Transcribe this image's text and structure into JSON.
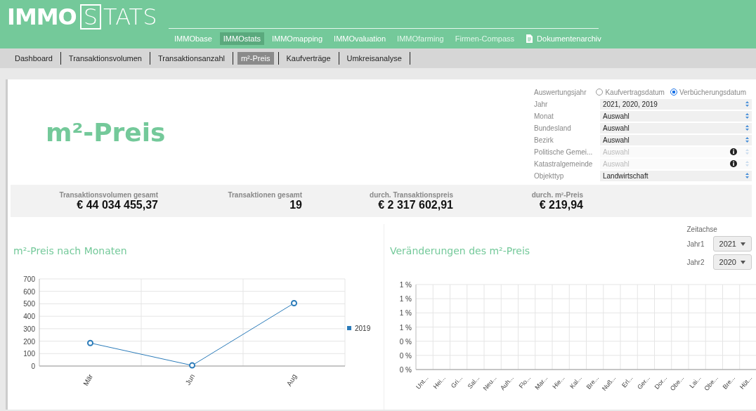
{
  "logo": {
    "bold": "IMMO",
    "boxed": "S",
    "rest": "TATS"
  },
  "nav": [
    {
      "label": "IMMObase",
      "selected": false,
      "disabled": false
    },
    {
      "label": "IMMOstats",
      "selected": true,
      "disabled": false
    },
    {
      "label": "IMMOmapping",
      "selected": false,
      "disabled": false
    },
    {
      "label": "IMMOvaluation",
      "selected": false,
      "disabled": false
    },
    {
      "label": "IMMOfarming",
      "selected": false,
      "disabled": true
    },
    {
      "label": "Firmen-Compass",
      "selected": false,
      "disabled": true
    },
    {
      "label": "Dokumentenarchiv",
      "selected": false,
      "disabled": false,
      "kind": "document"
    }
  ],
  "subnav": [
    {
      "label": "Dashboard",
      "selected": false
    },
    {
      "label": "Transaktionsvolumen",
      "selected": false
    },
    {
      "label": "Transaktionsanzahl",
      "selected": false
    },
    {
      "label": "m²-Preis",
      "selected": true
    },
    {
      "label": "Kaufverträge",
      "selected": false
    },
    {
      "label": "Umkreisanalyse",
      "selected": false
    }
  ],
  "page_title": "m²-Preis",
  "filters": {
    "radio_label": "Auswertungsjahr",
    "radio_options": [
      {
        "label": "Kaufvertragsdatum",
        "selected": false
      },
      {
        "label": "Verbücherungsdatum",
        "selected": true
      }
    ],
    "rows": [
      {
        "label": "Jahr",
        "value": "2021, 2020, 2019",
        "disabled": false,
        "info": false
      },
      {
        "label": "Monat",
        "value": "Auswahl",
        "disabled": false,
        "info": false
      },
      {
        "label": "Bundesland",
        "value": "Auswahl",
        "disabled": false,
        "info": false
      },
      {
        "label": "Bezirk",
        "value": "Auswahl",
        "disabled": false,
        "info": false
      },
      {
        "label": "Politische Gemei...",
        "value": "Auswahl",
        "disabled": true,
        "info": true
      },
      {
        "label": "Katastralgemeinde",
        "value": "Auswahl",
        "disabled": true,
        "info": true
      },
      {
        "label": "Objekttyp",
        "value": "Landwirtschaft",
        "disabled": false,
        "info": false
      }
    ]
  },
  "stats": [
    {
      "label": "Transaktionsvolumen gesamt",
      "value": "€ 44 034 455,37"
    },
    {
      "label": "Transaktionen gesamt",
      "value": "19"
    },
    {
      "label": "durch. Transaktionspreis",
      "value": "€ 2 317 602,91"
    },
    {
      "label": "durch. m²-Preis",
      "value": "€ 219,94"
    }
  ],
  "monthly_chart": {
    "title": "m²-Preis nach Monaten",
    "chart_data": {
      "type": "line",
      "categories": [
        "Mär",
        "Jun",
        "Aug"
      ],
      "series": [
        {
          "name": "2019",
          "color": "#2b7bb9",
          "values": [
            185,
            5,
            505
          ],
          "marker": "circle"
        }
      ],
      "grid": true,
      "ylim": [
        0,
        700
      ],
      "yticks": [
        0,
        100,
        200,
        300,
        400,
        500,
        600,
        700
      ]
    }
  },
  "change_chart": {
    "title": "Veränderungen des m²-Preis",
    "axis_label": "Zeitachse",
    "selects": [
      {
        "label": "Jahr1",
        "value": "2021"
      },
      {
        "label": "Jahr2",
        "value": "2020"
      }
    ],
    "chart_data": {
      "type": "line",
      "categories": [
        "Unt...",
        "Hei...",
        "Gri...",
        "Sal...",
        "Neu...",
        "Auh...",
        "Flo...",
        "Mar...",
        "Hie...",
        "Kal...",
        "Bre...",
        "Nuß...",
        "Erl...",
        "Ger...",
        "Dor...",
        "Obe...",
        "Lai...",
        "Obe...",
        "Bre...",
        "Hüt..."
      ],
      "grid": true,
      "ylim": [
        0,
        1.2
      ],
      "yticks": [
        {
          "value": 0,
          "label": "0 %"
        },
        {
          "value": 0.2,
          "label": "0 %"
        },
        {
          "value": 0.4,
          "label": "0 %"
        },
        {
          "value": 0.6,
          "label": "1 %"
        },
        {
          "value": 0.8,
          "label": "1 %"
        },
        {
          "value": 1,
          "label": "1 %"
        },
        {
          "value": 1.2,
          "label": "1 %"
        }
      ]
    }
  }
}
